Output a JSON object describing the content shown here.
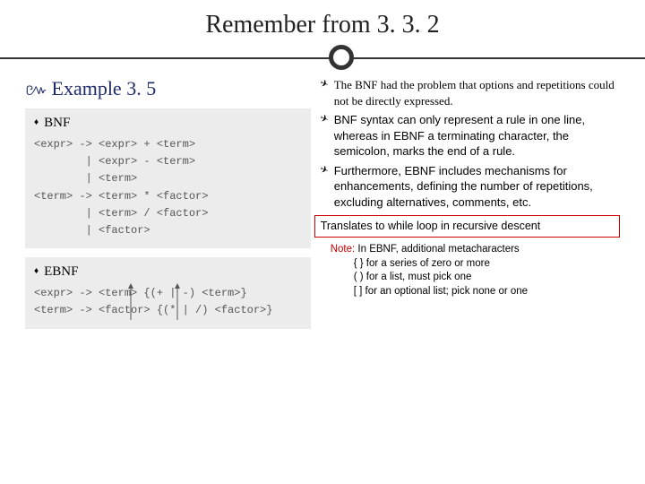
{
  "title": "Remember from 3. 3. 2",
  "left": {
    "heading": "Example 3. 5",
    "bnf": {
      "label": "BNF",
      "lines": [
        "<expr> -> <expr> + <term>",
        "        | <expr> - <term>",
        "        | <term>",
        "<term> -> <term> * <factor>",
        "        | <term> / <factor>",
        "        | <factor>"
      ]
    },
    "ebnf": {
      "label": "EBNF",
      "lines": [
        "<expr> -> <term> {(+ | -) <term>}",
        "<term> -> <factor> {(* | /) <factor>}"
      ]
    }
  },
  "right": {
    "bullets": [
      "The BNF had the problem that options and repetitions could not be directly expressed.",
      "BNF syntax can only represent a rule in one line, whereas in EBNF a terminating character, the semicolon, marks the end of a rule.",
      "Furthermore, EBNF includes mechanisms for enhancements, defining the number of repetitions, excluding alternatives, comments, etc."
    ],
    "translate": "Translates to while loop in recursive descent",
    "note": {
      "label": "Note:",
      "intro": " In EBNF, additional metacharacters",
      "metas": [
        "{  }  for a series of zero or more",
        "(  )  for a list, must pick one",
        "[  ]  for an optional list; pick none or one"
      ]
    }
  }
}
